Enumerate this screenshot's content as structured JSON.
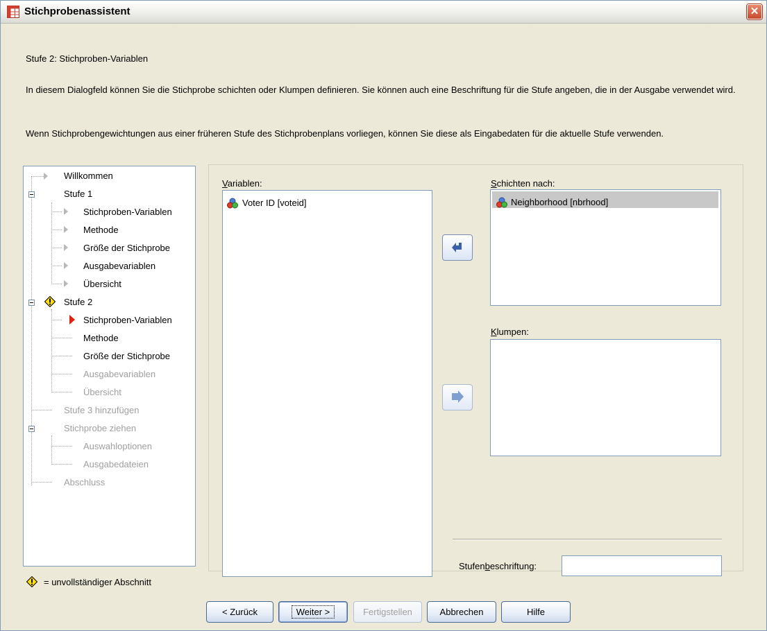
{
  "window": {
    "title": "Stichprobenassistent",
    "close_symbol": "✕"
  },
  "header": {
    "step_title": "Stufe 2: Stichproben-Variablen",
    "description_1": "In diesem Dialogfeld können Sie die Stichprobe schichten oder Klumpen definieren. Sie können auch eine Beschriftung für die Stufe angeben, die in der Ausgabe verwendet wird.",
    "description_2": "Wenn Stichprobengewichtungen aus einer früheren Stufe des Stichprobenplans vorliegen, können Sie diese als Eingabedaten für die aktuelle Stufe verwenden."
  },
  "tree": {
    "willkommen": "Willkommen",
    "stufe1": "Stufe 1",
    "s1_variablen": "Stichproben-Variablen",
    "s1_methode": "Methode",
    "s1_groesse": "Größe der Stichprobe",
    "s1_ausgabevariablen": "Ausgabevariablen",
    "s1_uebersicht": "Übersicht",
    "stufe2": "Stufe 2",
    "s2_variablen": "Stichproben-Variablen",
    "s2_methode": "Methode",
    "s2_groesse": "Größe der Stichprobe",
    "s2_ausgabevariablen": "Ausgabevariablen",
    "s2_uebersicht": "Übersicht",
    "stufe3": "Stufe 3 hinzufügen",
    "ziehen": "Stichprobe ziehen",
    "auswahloptionen": "Auswahloptionen",
    "ausgabedateien": "Ausgabedateien",
    "abschluss": "Abschluss"
  },
  "legend": {
    "text": "= unvollständiger Abschnitt"
  },
  "variables": {
    "label_first": "V",
    "label_rest": "ariablen:",
    "items": [
      "Voter ID [voteid]"
    ]
  },
  "strata": {
    "label_first": "S",
    "label_rest": "chichten nach:",
    "items": [
      "Neighborhood [nbrhood]"
    ]
  },
  "clusters": {
    "label_first": "K",
    "label_rest": "lumpen:",
    "items": []
  },
  "stage_label": {
    "label_pre": "Stufen",
    "label_ul": "b",
    "label_post": "eschriftung:",
    "value": ""
  },
  "buttons": {
    "back": "< Zurück",
    "next": "Weiter >",
    "finish": "Fertigstellen",
    "cancel": "Abbrechen",
    "help": "Hilfe"
  },
  "colors": {
    "accent_blue": "#4a6a9a",
    "warning_yellow": "#ffe000",
    "current_marker": "#e02010"
  }
}
